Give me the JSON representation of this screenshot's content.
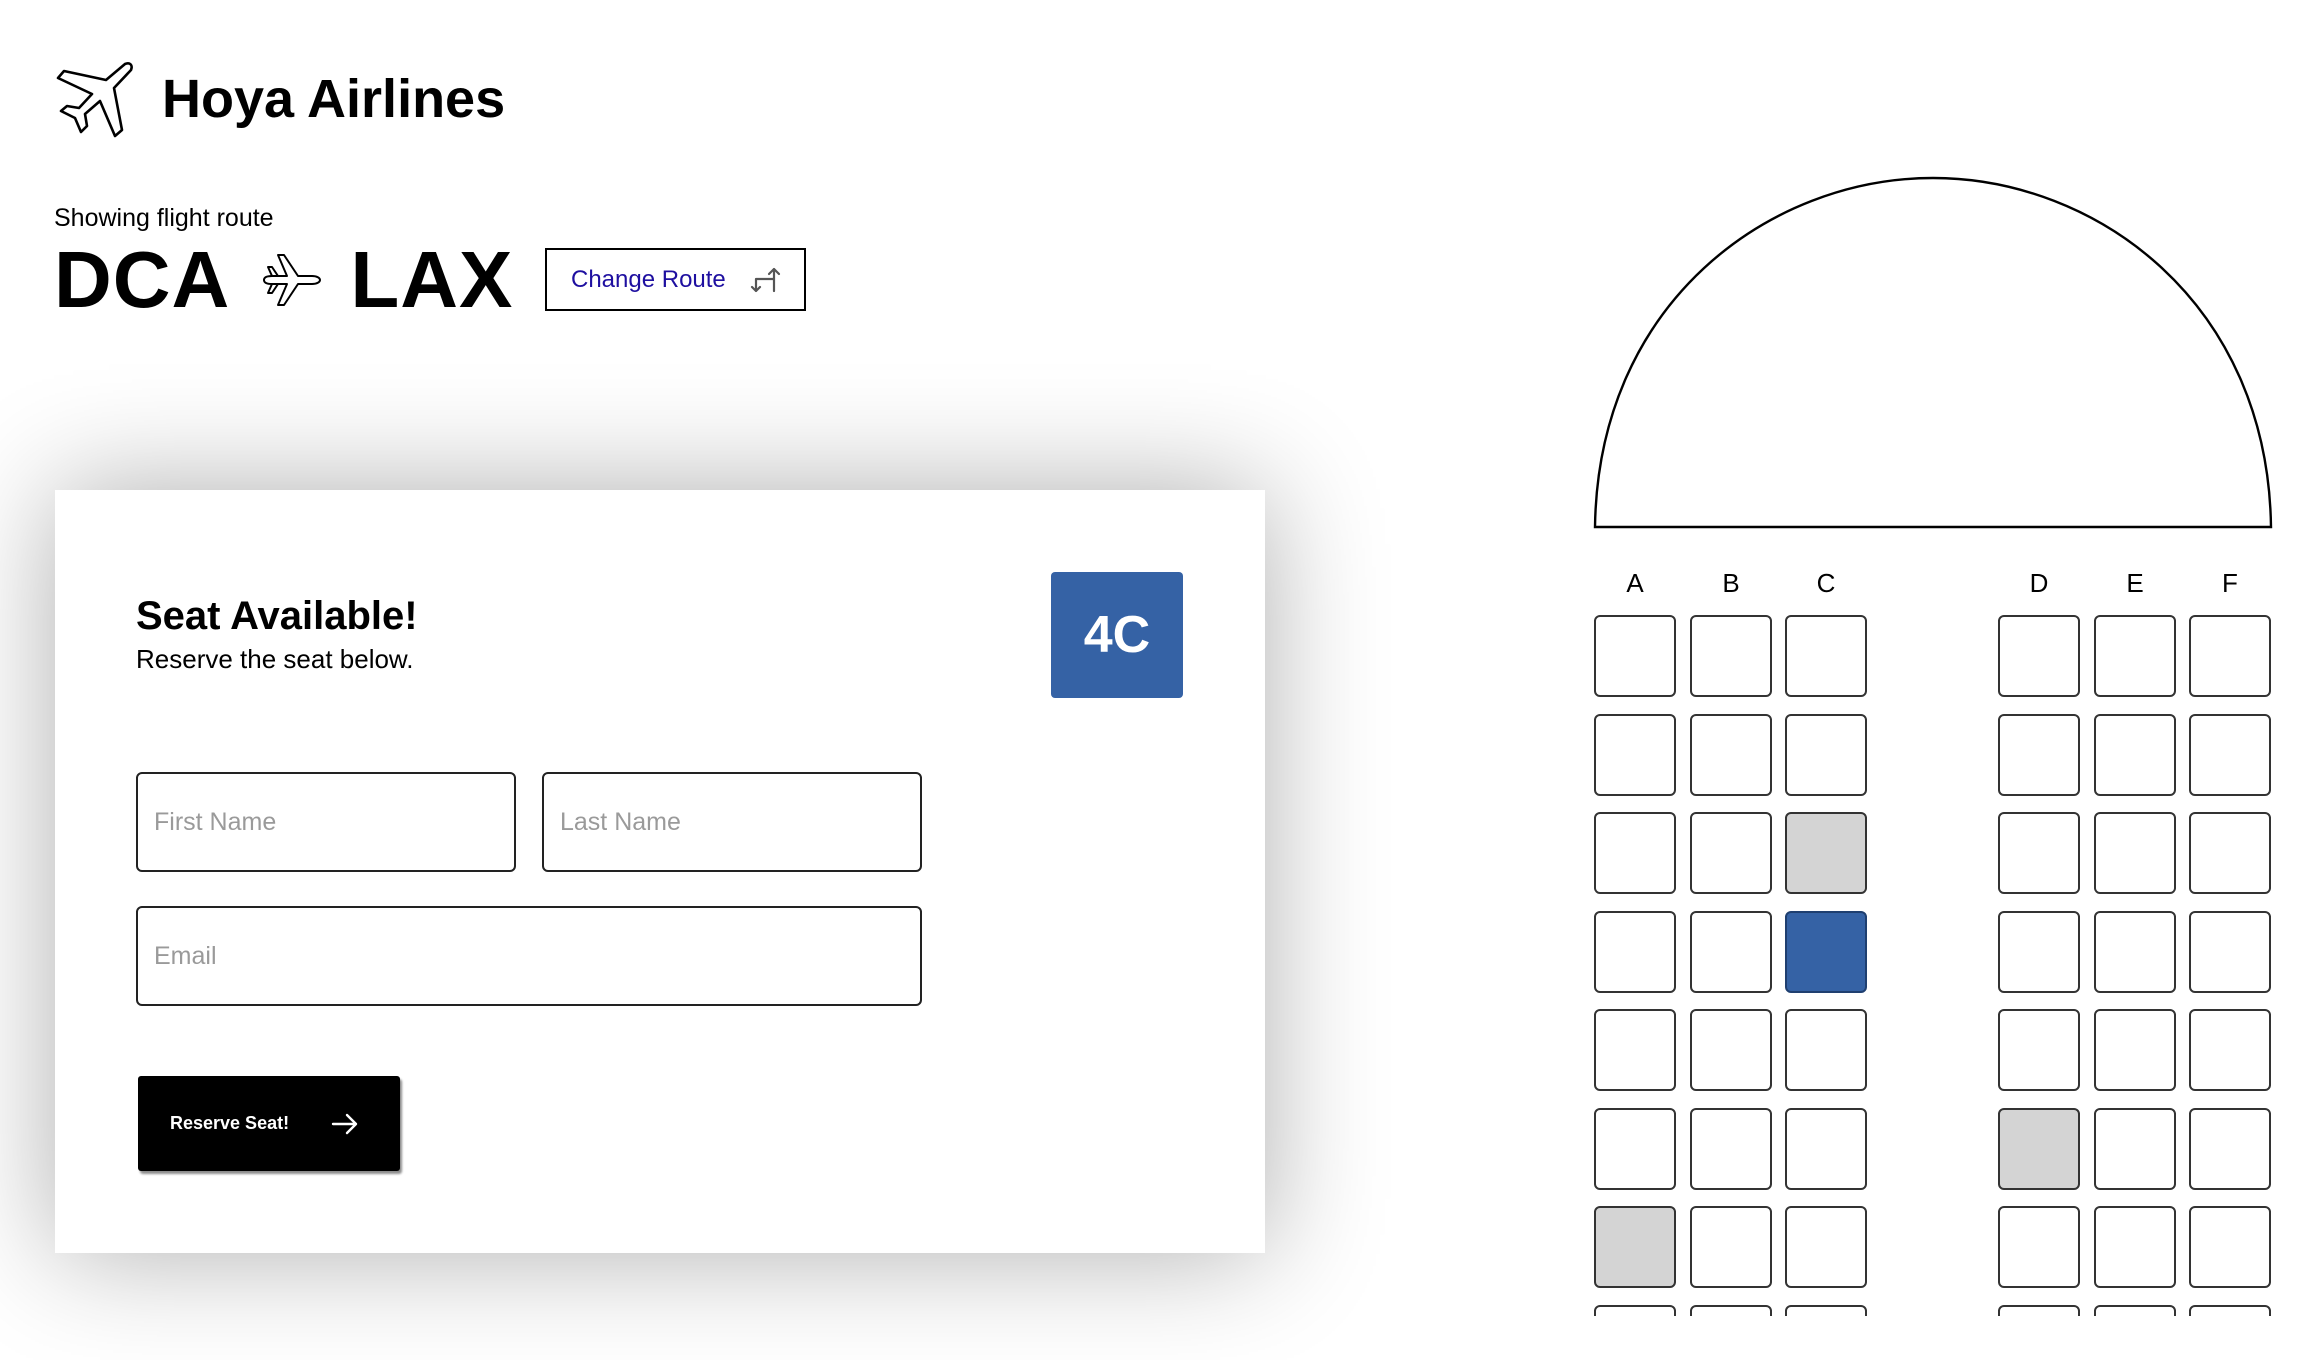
{
  "header": {
    "brand_name": "Hoya Airlines",
    "brand_icon": "airplane-outline-icon"
  },
  "route": {
    "caption": "Showing flight route",
    "origin": "DCA",
    "destination": "LAX",
    "route_icon": "airplane-right-icon",
    "change_label": "Change Route",
    "change_icon": "swap-arrows-icon"
  },
  "reservation": {
    "title": "Seat Available!",
    "subtitle": "Reserve the seat below.",
    "seat_code": "4C",
    "first_name_placeholder": "First Name",
    "last_name_placeholder": "Last Name",
    "email_placeholder": "Email",
    "submit_label": "Reserve Seat!",
    "submit_icon": "arrow-right-icon"
  },
  "seat_map": {
    "columns": [
      "A",
      "B",
      "C",
      "D",
      "E",
      "F"
    ],
    "visible_rows": 7,
    "occupied": [
      "3C",
      "6D",
      "7A"
    ],
    "selected": "4C",
    "colors": {
      "selected": "#3562a5",
      "occupied": "#d4d4d4",
      "available": "#ffffff"
    }
  }
}
